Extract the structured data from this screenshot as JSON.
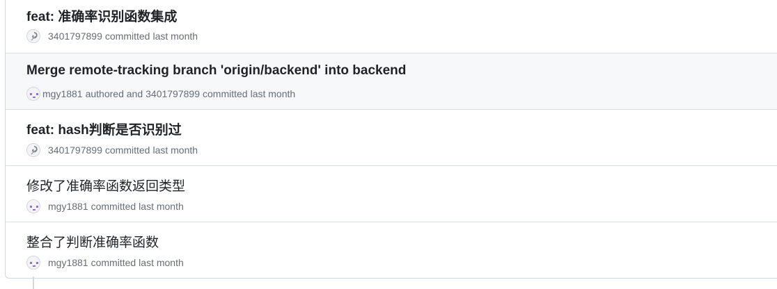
{
  "commits": [
    {
      "title": "feat: 准确率识别函数集成",
      "avatar_icon": "spiral-avatar-icon",
      "meta": [
        "3401797899",
        "committed",
        "last month"
      ]
    },
    {
      "title": "Merge remote-tracking branch 'origin/backend' into backend",
      "avatars": [
        "purple-face-avatar-icon",
        "spiral-avatar-icon"
      ],
      "meta": [
        "mgy1881",
        "authored and",
        "3401797899",
        "committed",
        "last month"
      ]
    },
    {
      "title": "feat: hash判断是否识别过",
      "avatar_icon": "spiral-avatar-icon",
      "meta": [
        "3401797899",
        "committed",
        "last month"
      ]
    },
    {
      "title": "修改了准确率函数返回类型",
      "avatar_icon": "purple-face-avatar-icon",
      "meta": [
        "mgy1881",
        "committed",
        "last month"
      ]
    },
    {
      "title": "整合了判断准确率函数",
      "avatar_icon": "purple-face-avatar-icon",
      "meta": [
        "mgy1881",
        "committed",
        "last month"
      ]
    }
  ],
  "colors": {
    "avatar_purple": "#8f6fd8",
    "row_highlight": "#f6f8fa",
    "border": "#d0d7de"
  }
}
